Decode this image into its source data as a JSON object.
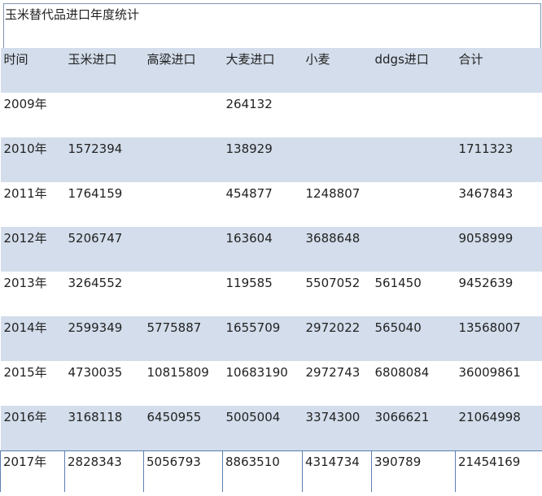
{
  "title": "玉米替代品进口年度统计",
  "table": {
    "headers": [
      "时间",
      "玉米进口",
      "高粱进口",
      "大麦进口",
      "小麦",
      "ddgs进口",
      "合计"
    ],
    "rows": [
      [
        "2009年",
        "",
        "",
        "264132",
        "",
        "",
        ""
      ],
      [
        "2010年",
        "1572394",
        "",
        "138929",
        "",
        "",
        "1711323"
      ],
      [
        "2011年",
        "1764159",
        "",
        "454877",
        "1248807",
        "",
        "3467843"
      ],
      [
        "2012年",
        "5206747",
        "",
        "163604",
        "3688648",
        "",
        "9058999"
      ],
      [
        "2013年",
        "3264552",
        "",
        "119585",
        "5507052",
        "561450",
        "9452639"
      ],
      [
        "2014年",
        "2599349",
        "5775887",
        "1655709",
        "2972022",
        "565040",
        "13568007"
      ],
      [
        "2015年",
        "4730035",
        "10815809",
        "10683190",
        "2972743",
        "6808084",
        "36009861"
      ],
      [
        "2016年",
        "3168118",
        "6450955",
        "5005004",
        "3374300",
        "3066621",
        "21064998"
      ],
      [
        "2017年",
        "2828343",
        "5056793",
        "8863510",
        "4314734",
        "390789",
        "21454169"
      ]
    ]
  },
  "colors": {
    "band": "#d3ddeb",
    "border": "#5b7fb0",
    "text": "#222222"
  }
}
